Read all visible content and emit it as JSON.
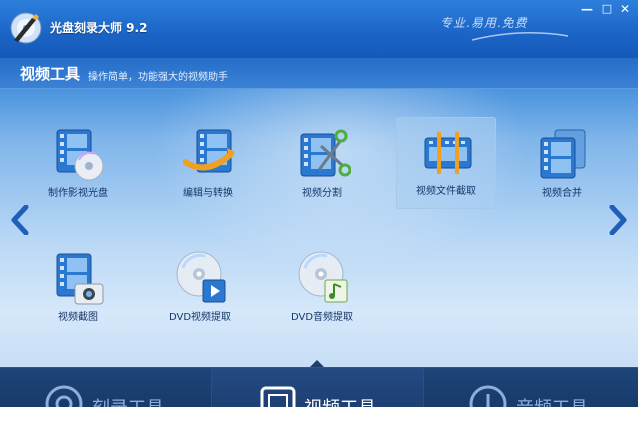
{
  "window": {
    "title": "光盘刻录大师 9.2",
    "slogan": "专业.易用.免费",
    "buttons": {
      "minimize": "—",
      "maximize": "□",
      "close": "✕"
    }
  },
  "section": {
    "title": "视频工具",
    "subtitle": "操作简单，功能强大的视频助手"
  },
  "tools": [
    {
      "label": "制作影视光盘",
      "icon": "film-disc-icon"
    },
    {
      "label": "编辑与转换",
      "icon": "film-convert-icon"
    },
    {
      "label": "视频分割",
      "icon": "film-scissors-icon"
    },
    {
      "label": "视频文件截取",
      "icon": "film-trim-icon",
      "selected": true
    },
    {
      "label": "视频合并",
      "icon": "film-merge-icon"
    },
    {
      "label": "视频截图",
      "icon": "film-camera-icon"
    },
    {
      "label": "DVD视频提取",
      "icon": "dvd-video-icon"
    },
    {
      "label": "DVD音频提取",
      "icon": "dvd-audio-icon"
    }
  ],
  "nav": {
    "prev_icon": "chevron-left-icon",
    "next_icon": "chevron-right-icon"
  },
  "tabs": [
    {
      "label": "刻录工具",
      "icon": "disc-icon"
    },
    {
      "label": "视频工具",
      "icon": "film-icon",
      "active": true
    },
    {
      "label": "音频工具",
      "icon": "music-note-icon"
    }
  ],
  "colors": {
    "titlebar": "#1a64c6",
    "content_top": "#4a93de",
    "content_bottom": "#c7def6",
    "tabbar": "#1e4479",
    "label_text": "#16386b",
    "accent_orange": "#f0a020"
  }
}
